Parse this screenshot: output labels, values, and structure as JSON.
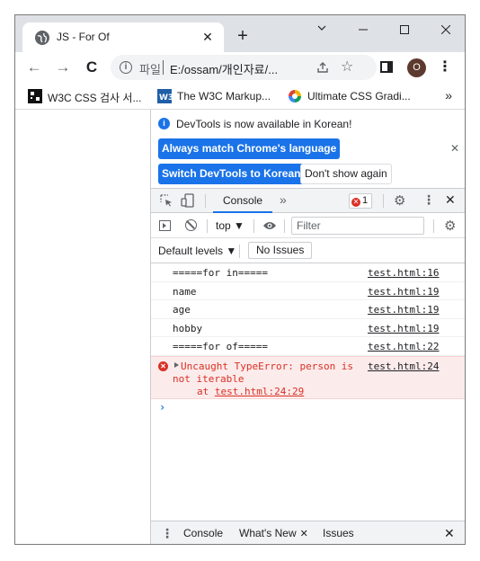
{
  "browser": {
    "tab_title": "JS - For Of",
    "tab_close": "✕",
    "new_tab": "+",
    "controls": {
      "minimize": "—",
      "maximize": "☐",
      "close": "✕",
      "chevron": "⌄"
    },
    "address": {
      "origin": "파일",
      "url": "E:/ossam/개인자료/..."
    },
    "profile_initial": "O"
  },
  "bookmarks": [
    {
      "label": "W3C CSS 검사 서..."
    },
    {
      "label": "The W3C Markup..."
    },
    {
      "label": "Ultimate CSS Gradi..."
    }
  ],
  "bookmarks_more": "»",
  "devtools": {
    "infobar": {
      "message": "DevTools is now available in Korean!",
      "btn_match": "Always match Chrome's language",
      "btn_switch": "Switch DevTools to Korean",
      "btn_dismiss": "Don't show again"
    },
    "tabs": {
      "console": "Console",
      "more": "»",
      "error_count": "1"
    },
    "toolbar": {
      "context": "top ▼",
      "filter_placeholder": "Filter"
    },
    "levels": "Default levels ▼",
    "issues_btn": "No Issues",
    "logs": [
      {
        "text": "=====for in=====",
        "source": "test.html:16"
      },
      {
        "text": "name",
        "source": "test.html:19"
      },
      {
        "text": "age",
        "source": "test.html:19"
      },
      {
        "text": "hobby",
        "source": "test.html:19"
      },
      {
        "text": "=====for of=====",
        "source": "test.html:22"
      }
    ],
    "error": {
      "line1": "Uncaught TypeError: person is",
      "line2": "not iterable",
      "at_label": "at",
      "location": "test.html:24:29",
      "source": "test.html:24"
    },
    "prompt": "›",
    "drawer": {
      "console": "Console",
      "whats_new": "What's New",
      "issues": "Issues"
    }
  },
  "colors": {
    "accent": "#1a73e8",
    "error": "#d93025",
    "error_bg": "#fcebeb",
    "tabstrip": "#dee1e6"
  }
}
